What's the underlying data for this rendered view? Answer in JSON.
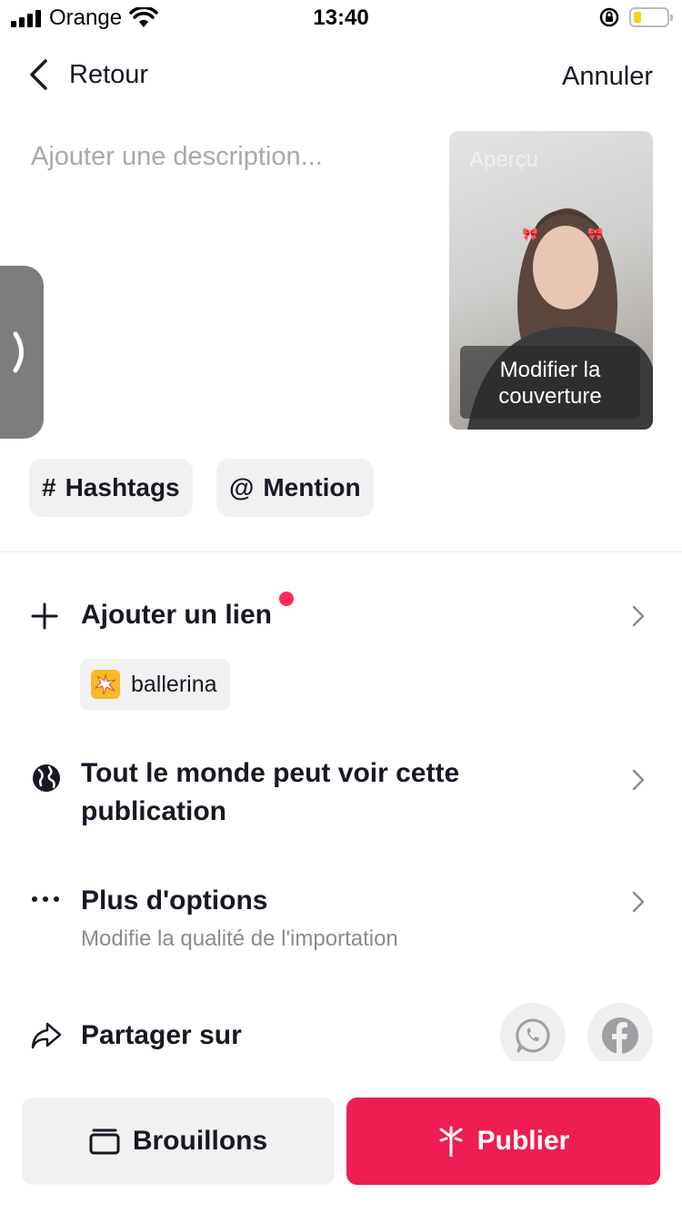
{
  "status_bar": {
    "carrier": "Orange",
    "time": "13:40"
  },
  "header": {
    "back_label": "Retour",
    "cancel_label": "Annuler"
  },
  "description": {
    "placeholder": "Ajouter une description..."
  },
  "cover": {
    "preview_label": "Aperçu",
    "edit_label_line1": "Modifier la",
    "edit_label_line2": "couverture"
  },
  "chips": {
    "hashtags": {
      "symbol": "#",
      "label": "Hashtags"
    },
    "mention": {
      "symbol": "@",
      "label": "Mention"
    }
  },
  "options": {
    "add_link": {
      "label": "Ajouter un lien",
      "has_new_dot": true
    },
    "link_tag": {
      "label": "ballerina",
      "icon": "sparkle-icon"
    },
    "visibility": {
      "label_line1": "Tout le monde peut voir cette",
      "label_line2": "publication"
    },
    "more_options": {
      "label": "Plus d'options",
      "subtitle": "Modifie la qualité de l'importation"
    },
    "share": {
      "label": "Partager sur",
      "targets": [
        "whatsapp",
        "facebook"
      ]
    }
  },
  "actions": {
    "drafts_label": "Brouillons",
    "publish_label": "Publier"
  },
  "colors": {
    "publish": "#ee1d52",
    "notification_dot": "#fe2c55",
    "battery_fill": "#f6d314"
  }
}
